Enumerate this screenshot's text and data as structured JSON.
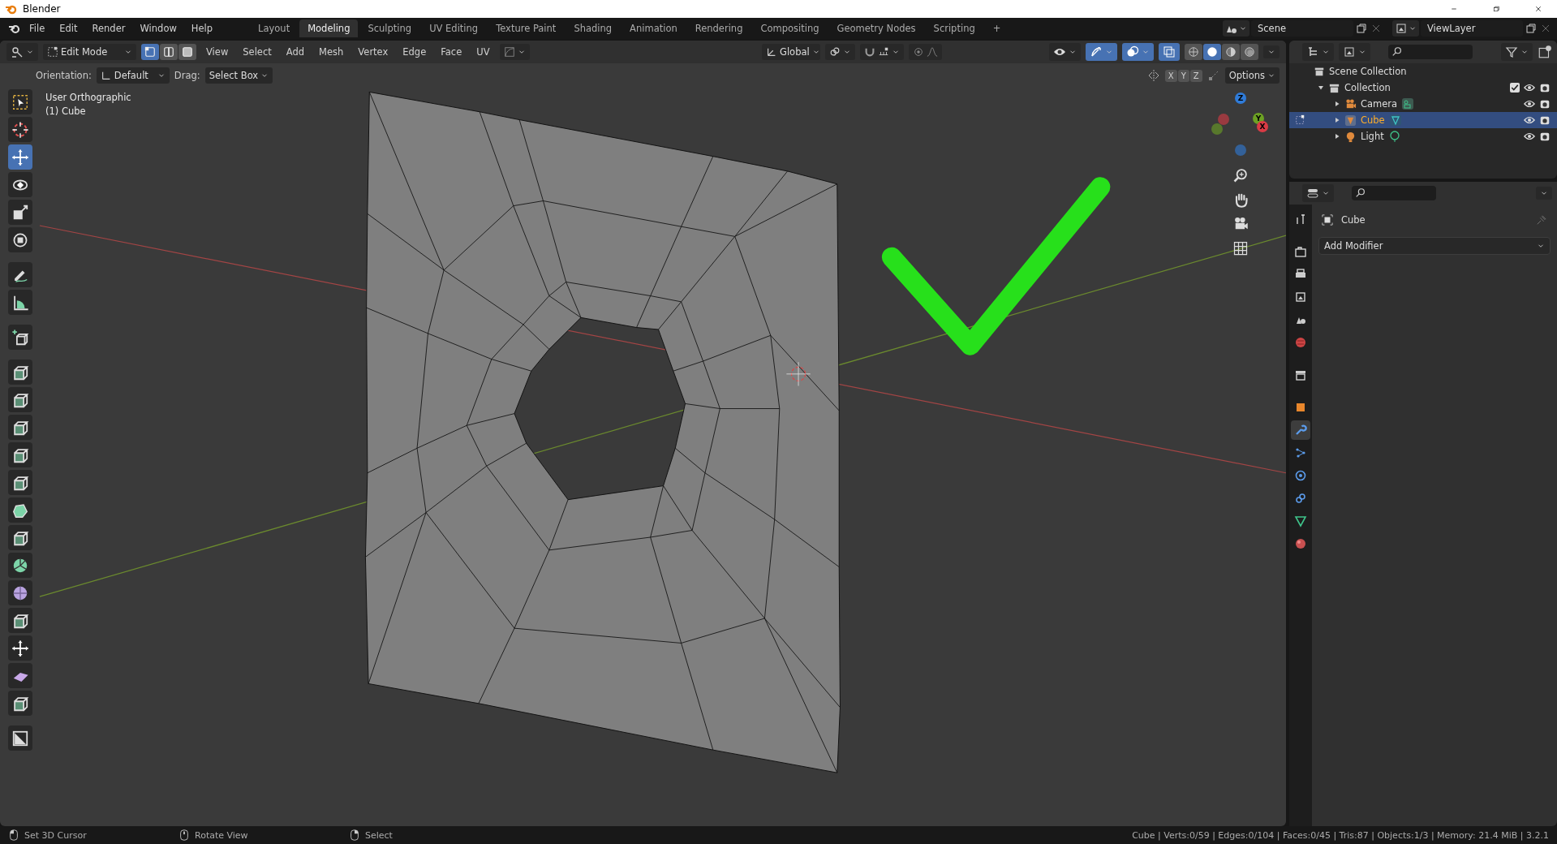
{
  "window": {
    "title": "Blender"
  },
  "menu": [
    "File",
    "Edit",
    "Render",
    "Window",
    "Help"
  ],
  "workspaces": [
    {
      "label": "Layout",
      "selected": false
    },
    {
      "label": "Modeling",
      "selected": true
    },
    {
      "label": "Sculpting",
      "selected": false
    },
    {
      "label": "UV Editing",
      "selected": false
    },
    {
      "label": "Texture Paint",
      "selected": false
    },
    {
      "label": "Shading",
      "selected": false
    },
    {
      "label": "Animation",
      "selected": false
    },
    {
      "label": "Rendering",
      "selected": false
    },
    {
      "label": "Compositing",
      "selected": false
    },
    {
      "label": "Geometry Nodes",
      "selected": false
    },
    {
      "label": "Scripting",
      "selected": false
    }
  ],
  "add_workspace": "+",
  "scene": {
    "name": "Scene"
  },
  "view_layer": {
    "name": "ViewLayer"
  },
  "header": {
    "mode": "Edit Mode",
    "select_modes": [
      {
        "kind": "vertex",
        "selected": true
      },
      {
        "kind": "edge",
        "selected": false
      },
      {
        "kind": "face",
        "selected": false
      }
    ],
    "menus": [
      "View",
      "Select",
      "Add",
      "Mesh",
      "Vertex",
      "Edge",
      "Face",
      "UV"
    ],
    "transform_orientation": "Global",
    "axes": [
      "X",
      "Y",
      "Z"
    ],
    "options": "Options"
  },
  "tool_settings": {
    "orientation_label": "Orientation:",
    "orientation": "Default",
    "drag_label": "Drag:",
    "drag": "Select Box"
  },
  "viewport": {
    "view_name": "User Orthographic",
    "object": "(1) Cube",
    "gizmo_axes": [
      "Z",
      "Y",
      "X"
    ]
  },
  "tools": [
    {
      "kind": "select-box",
      "selected": false
    },
    {
      "kind": "cursor",
      "selected": false
    },
    {
      "kind": "move",
      "selected": true
    },
    {
      "kind": "rotate",
      "selected": false
    },
    {
      "kind": "scale",
      "selected": false
    },
    {
      "kind": "transform",
      "selected": false
    },
    {
      "kind": "pencil",
      "selected": false
    },
    {
      "kind": "ruler",
      "selected": false
    },
    {
      "kind": "cube-plus",
      "selected": false
    },
    {
      "kind": "cube",
      "selected": false
    },
    {
      "kind": "cube",
      "selected": false
    },
    {
      "kind": "cube",
      "selected": false
    },
    {
      "kind": "cube",
      "selected": false
    },
    {
      "kind": "cube",
      "selected": false
    },
    {
      "kind": "polygon",
      "selected": false
    },
    {
      "kind": "cube",
      "selected": false
    },
    {
      "kind": "pie",
      "selected": false
    },
    {
      "kind": "sphere",
      "selected": false
    },
    {
      "kind": "cube",
      "selected": false
    },
    {
      "kind": "move",
      "selected": false
    },
    {
      "kind": "wedge",
      "selected": false
    },
    {
      "kind": "cube",
      "selected": false
    },
    {
      "kind": "square",
      "selected": false
    }
  ],
  "outliner": {
    "root": "Scene Collection",
    "items": [
      {
        "label": "Collection",
        "kind": "collection",
        "expanded": true,
        "checked": true,
        "selected": false,
        "children": [
          {
            "label": "Camera",
            "kind": "camera",
            "expanded": false,
            "selected": false
          },
          {
            "label": "Cube",
            "kind": "mesh",
            "expanded": false,
            "selected": true
          },
          {
            "label": "Light",
            "kind": "light",
            "expanded": false,
            "selected": false
          }
        ]
      }
    ]
  },
  "properties": {
    "tabs": [
      {
        "kind": "tool",
        "selected": false
      },
      {
        "kind": "render",
        "selected": false
      },
      {
        "kind": "output",
        "selected": false
      },
      {
        "kind": "view-layer",
        "selected": false
      },
      {
        "kind": "scene",
        "selected": false
      },
      {
        "kind": "world",
        "selected": false
      },
      {
        "kind": "collection",
        "selected": false
      },
      {
        "kind": "object",
        "selected": false
      },
      {
        "kind": "modifier",
        "selected": true
      },
      {
        "kind": "particles",
        "selected": false
      },
      {
        "kind": "physics",
        "selected": false
      },
      {
        "kind": "constraints",
        "selected": false
      },
      {
        "kind": "data",
        "selected": false
      },
      {
        "kind": "material",
        "selected": false
      }
    ],
    "object": "Cube",
    "add_modifier": "Add Modifier"
  },
  "status_bar": {
    "hints": [
      "Set 3D Cursor",
      "Rotate View",
      "Select"
    ],
    "stats": "Cube | Verts:0/59 | Edges:0/104 | Faces:0/45 | Tris:87 | Objects:1/3 | Memory: 21.4 MiB | 3.2.1"
  }
}
